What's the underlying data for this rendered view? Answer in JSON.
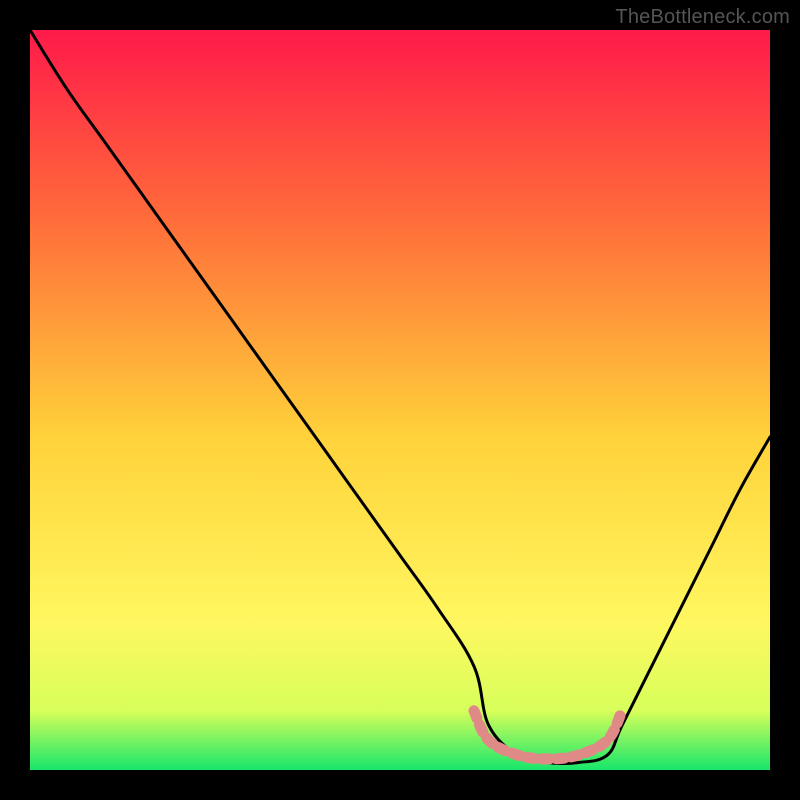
{
  "watermark": "TheBottleneck.com",
  "chart_data": {
    "type": "line",
    "title": "",
    "xlabel": "",
    "ylabel": "",
    "xlim": [
      0,
      100
    ],
    "ylim": [
      0,
      100
    ],
    "grid": false,
    "background_gradient": {
      "top": "#ff1a4a",
      "mid_upper": "#ff6a3a",
      "mid": "#ffd23a",
      "mid_lower": "#fff760",
      "bottom": "#17e66b"
    },
    "series": [
      {
        "name": "bottleneck-curve",
        "x": [
          0,
          5,
          10,
          15,
          20,
          25,
          30,
          35,
          40,
          45,
          50,
          55,
          60,
          62,
          66,
          70,
          74,
          78,
          80,
          84,
          88,
          92,
          96,
          100
        ],
        "values": [
          100,
          92,
          85,
          78,
          71,
          64,
          57,
          50,
          43,
          36,
          29,
          22,
          14,
          6,
          2,
          1,
          1,
          2,
          6,
          14,
          22,
          30,
          38,
          45
        ]
      },
      {
        "name": "valley-highlight",
        "x": [
          60,
          62,
          66,
          70,
          74,
          78,
          80
        ],
        "values": [
          8,
          4,
          2,
          1.5,
          2,
          4,
          8
        ]
      }
    ],
    "annotations": []
  },
  "colors": {
    "curve": "#000000",
    "highlight": "#e08a88"
  }
}
